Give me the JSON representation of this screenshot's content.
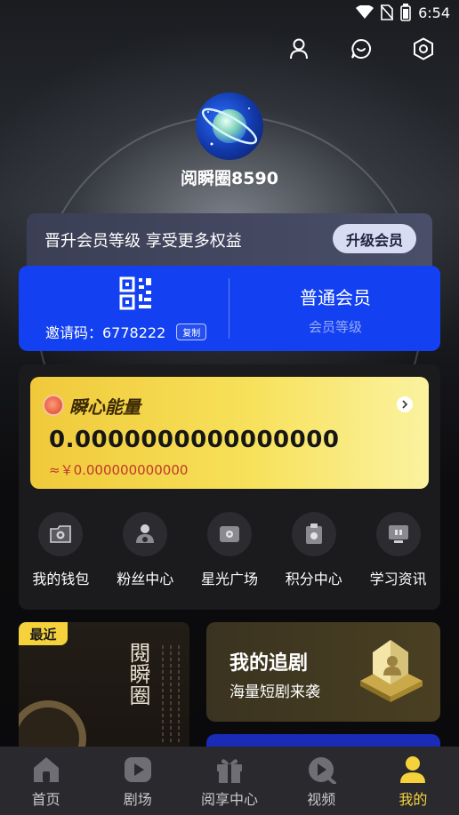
{
  "status_bar": {
    "time": "6:54"
  },
  "header": {
    "icons": [
      "profile-icon",
      "message-icon",
      "settings-icon"
    ]
  },
  "profile": {
    "username": "阅瞬圈8590"
  },
  "upgrade_banner": {
    "text": "晋升会员等级 享受更多权益",
    "button": "升级会员"
  },
  "member_card": {
    "invite_label": "邀请码：6778222",
    "copy_label": "复制",
    "level": "普通会员",
    "level_caption": "会员等级"
  },
  "energy": {
    "title": "瞬心能量",
    "value": "0.0000000000000000",
    "rmb": "≈￥0.000000000000"
  },
  "features": [
    {
      "label": "我的钱包",
      "icon": "wallet-icon"
    },
    {
      "label": "粉丝中心",
      "icon": "fans-icon"
    },
    {
      "label": "星光广场",
      "icon": "plaza-icon"
    },
    {
      "label": "积分中心",
      "icon": "points-icon"
    },
    {
      "label": "学习资讯",
      "icon": "news-icon"
    }
  ],
  "recent": {
    "badge": "最近",
    "brand": "閱瞬圈"
  },
  "drama_card": {
    "title": "我的追剧",
    "subtitle": "海量短剧来袭"
  },
  "tabs": [
    {
      "label": "首页",
      "icon": "home-icon",
      "active": false
    },
    {
      "label": "剧场",
      "icon": "play-icon",
      "active": false
    },
    {
      "label": "阅享中心",
      "icon": "gift-icon",
      "active": false
    },
    {
      "label": "视频",
      "icon": "video-icon",
      "active": false
    },
    {
      "label": "我的",
      "icon": "user-icon",
      "active": true
    }
  ],
  "colors": {
    "accent_yellow": "#f5d23b",
    "member_blue": "#1340f0",
    "tabbar_bg": "#2a2a2e"
  }
}
